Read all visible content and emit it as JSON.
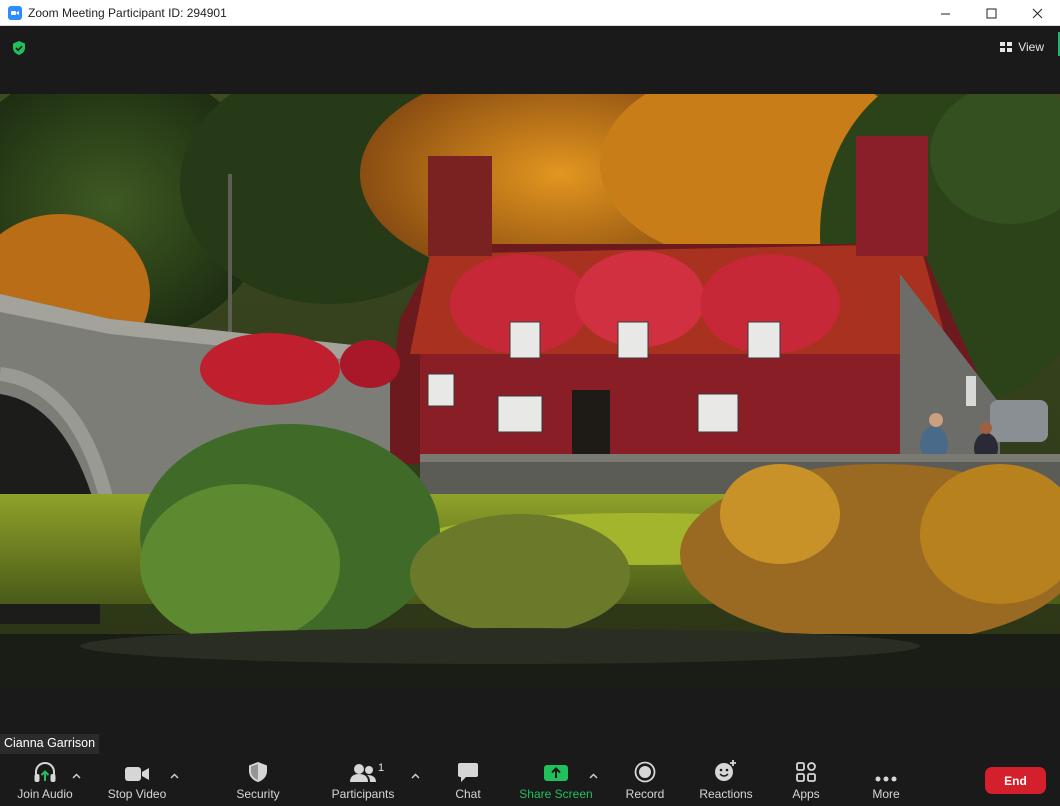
{
  "window": {
    "title": "Zoom Meeting Participant ID: 294901",
    "controls": [
      "minimize-icon",
      "maximize-icon",
      "close-icon"
    ]
  },
  "header": {
    "security_badge": "shield-check-icon",
    "view_label": "View"
  },
  "video": {
    "participant_name": "Cianna Garrison"
  },
  "toolbar": {
    "join_audio": "Join Audio",
    "stop_video": "Stop Video",
    "security": "Security",
    "participants": "Participants",
    "participants_count": "1",
    "chat": "Chat",
    "share_screen": "Share Screen",
    "record": "Record",
    "reactions": "Reactions",
    "apps": "Apps",
    "more": "More",
    "end": "End"
  },
  "colors": {
    "accent_green": "#20c05c",
    "end_red": "#d4202d",
    "zoom_blue": "#2d8cff",
    "background": "#1a1a1a"
  }
}
